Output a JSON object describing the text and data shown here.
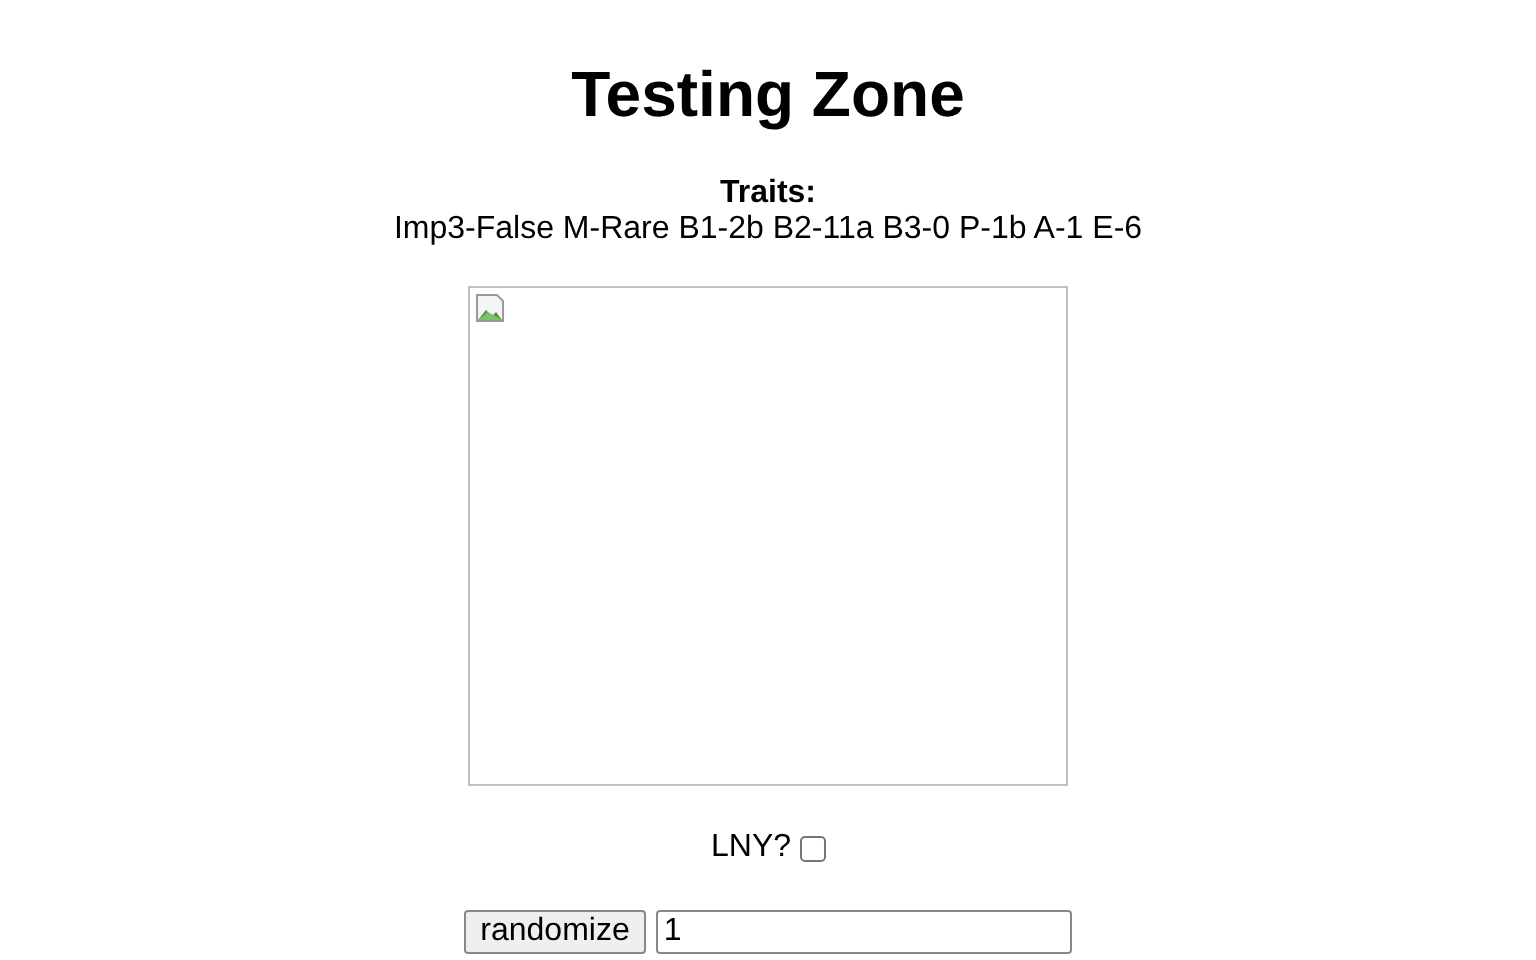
{
  "title": "Testing Zone",
  "traits": {
    "heading": "Traits:",
    "text": "Imp3-False M-Rare B1-2b B2-11a B3-0 P-1b A-1 E-6"
  },
  "image": {
    "kind": "broken"
  },
  "lny": {
    "label": "LNY?",
    "checked": false
  },
  "controls": {
    "button": "randomize",
    "value": "1"
  }
}
